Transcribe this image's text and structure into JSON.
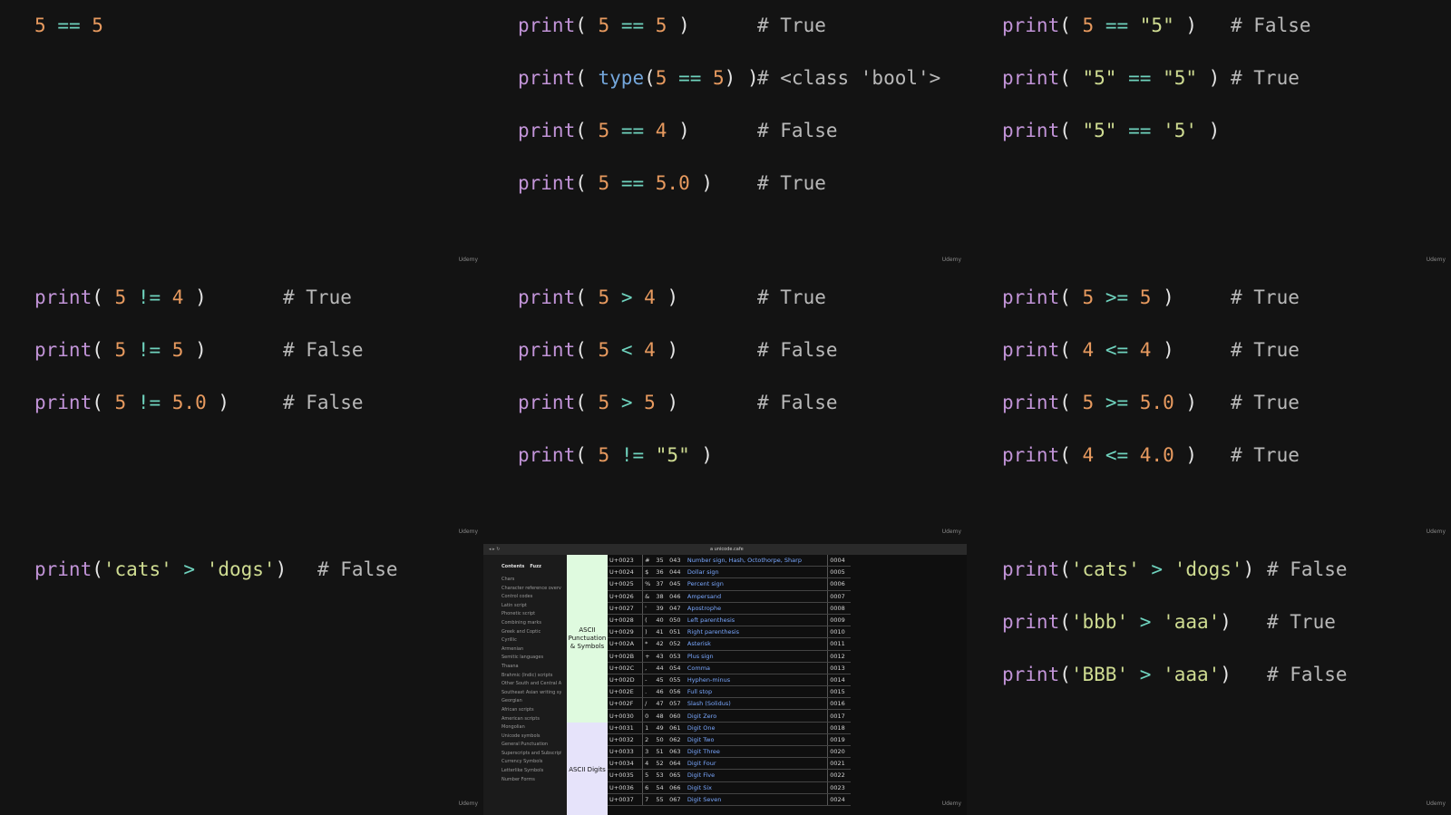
{
  "watermark": "Udemy",
  "panels": [
    {
      "lines": [
        {
          "code": [
            [
              "n",
              "5"
            ],
            [
              "p",
              " "
            ],
            [
              "o",
              "=="
            ],
            [
              "p",
              " "
            ],
            [
              "n",
              "5"
            ]
          ],
          "comment": ""
        }
      ]
    },
    {
      "lines": [
        {
          "code": [
            [
              "fn",
              "print"
            ],
            [
              "p",
              "( "
            ],
            [
              "n",
              "5"
            ],
            [
              "p",
              " "
            ],
            [
              "o",
              "=="
            ],
            [
              "p",
              " "
            ],
            [
              "n",
              "5"
            ],
            [
              "p",
              " )"
            ]
          ],
          "comment": "# True"
        },
        {
          "code": [
            [
              "fn",
              "print"
            ],
            [
              "p",
              "( "
            ],
            [
              "t",
              "type"
            ],
            [
              "p",
              "("
            ],
            [
              "n",
              "5"
            ],
            [
              "p",
              " "
            ],
            [
              "o",
              "=="
            ],
            [
              "p",
              " "
            ],
            [
              "n",
              "5"
            ],
            [
              "p",
              ") )"
            ]
          ],
          "comment": "# <class 'bool'>"
        },
        {
          "code": [
            [
              "fn",
              "print"
            ],
            [
              "p",
              "( "
            ],
            [
              "n",
              "5"
            ],
            [
              "p",
              " "
            ],
            [
              "o",
              "=="
            ],
            [
              "p",
              " "
            ],
            [
              "n",
              "4"
            ],
            [
              "p",
              " )"
            ]
          ],
          "comment": "# False"
        },
        {
          "code": [
            [
              "fn",
              "print"
            ],
            [
              "p",
              "( "
            ],
            [
              "n",
              "5"
            ],
            [
              "p",
              " "
            ],
            [
              "o",
              "=="
            ],
            [
              "p",
              " "
            ],
            [
              "n",
              "5.0"
            ],
            [
              "p",
              " )"
            ]
          ],
          "comment": "# True"
        }
      ]
    },
    {
      "lines": [
        {
          "code": [
            [
              "fn",
              "print"
            ],
            [
              "p",
              "( "
            ],
            [
              "n",
              "5"
            ],
            [
              "p",
              " "
            ],
            [
              "o",
              "=="
            ],
            [
              "p",
              " "
            ],
            [
              "s",
              "\"5\""
            ],
            [
              "p",
              " )"
            ]
          ],
          "comment": "# False"
        },
        {
          "code": [
            [
              "fn",
              "print"
            ],
            [
              "p",
              "( "
            ],
            [
              "s",
              "\"5\""
            ],
            [
              "p",
              " "
            ],
            [
              "o",
              "=="
            ],
            [
              "p",
              " "
            ],
            [
              "s",
              "\"5\""
            ],
            [
              "p",
              " )"
            ]
          ],
          "comment": "# True"
        },
        {
          "code": [
            [
              "fn",
              "print"
            ],
            [
              "p",
              "( "
            ],
            [
              "s",
              "\"5\""
            ],
            [
              "p",
              " "
            ],
            [
              "o",
              "=="
            ],
            [
              "p",
              " "
            ],
            [
              "s",
              "'5'"
            ],
            [
              "p",
              " )"
            ]
          ],
          "comment": ""
        }
      ]
    },
    {
      "lines": [
        {
          "code": [
            [
              "fn",
              "print"
            ],
            [
              "p",
              "( "
            ],
            [
              "n",
              "5"
            ],
            [
              "p",
              " "
            ],
            [
              "o",
              "!="
            ],
            [
              "p",
              " "
            ],
            [
              "n",
              "4"
            ],
            [
              "p",
              " )"
            ]
          ],
          "comment": "# True"
        },
        {
          "code": [
            [
              "fn",
              "print"
            ],
            [
              "p",
              "( "
            ],
            [
              "n",
              "5"
            ],
            [
              "p",
              " "
            ],
            [
              "o",
              "!="
            ],
            [
              "p",
              " "
            ],
            [
              "n",
              "5"
            ],
            [
              "p",
              " )"
            ]
          ],
          "comment": "# False"
        },
        {
          "code": [
            [
              "fn",
              "print"
            ],
            [
              "p",
              "( "
            ],
            [
              "n",
              "5"
            ],
            [
              "p",
              " "
            ],
            [
              "o",
              "!="
            ],
            [
              "p",
              " "
            ],
            [
              "n",
              "5.0"
            ],
            [
              "p",
              " )"
            ]
          ],
          "comment": "# False"
        }
      ]
    },
    {
      "lines": [
        {
          "code": [
            [
              "fn",
              "print"
            ],
            [
              "p",
              "( "
            ],
            [
              "n",
              "5"
            ],
            [
              "p",
              " "
            ],
            [
              "o",
              ">"
            ],
            [
              "p",
              " "
            ],
            [
              "n",
              "4"
            ],
            [
              "p",
              " )"
            ]
          ],
          "comment": "# True"
        },
        {
          "code": [
            [
              "fn",
              "print"
            ],
            [
              "p",
              "( "
            ],
            [
              "n",
              "5"
            ],
            [
              "p",
              " "
            ],
            [
              "o",
              "<"
            ],
            [
              "p",
              " "
            ],
            [
              "n",
              "4"
            ],
            [
              "p",
              " )"
            ]
          ],
          "comment": "# False"
        },
        {
          "code": [
            [
              "fn",
              "print"
            ],
            [
              "p",
              "( "
            ],
            [
              "n",
              "5"
            ],
            [
              "p",
              " "
            ],
            [
              "o",
              ">"
            ],
            [
              "p",
              " "
            ],
            [
              "n",
              "5"
            ],
            [
              "p",
              " )"
            ]
          ],
          "comment": "# False"
        },
        {
          "code": [
            [
              "fn",
              "print"
            ],
            [
              "p",
              "( "
            ],
            [
              "n",
              "5"
            ],
            [
              "p",
              " "
            ],
            [
              "o",
              "!="
            ],
            [
              "p",
              " "
            ],
            [
              "s",
              "\"5\""
            ],
            [
              "p",
              " )"
            ]
          ],
          "comment": ""
        }
      ]
    },
    {
      "lines": [
        {
          "code": [
            [
              "fn",
              "print"
            ],
            [
              "p",
              "( "
            ],
            [
              "n",
              "5"
            ],
            [
              "p",
              " "
            ],
            [
              "o",
              ">="
            ],
            [
              "p",
              " "
            ],
            [
              "n",
              "5"
            ],
            [
              "p",
              " )"
            ]
          ],
          "comment": "# True"
        },
        {
          "code": [
            [
              "fn",
              "print"
            ],
            [
              "p",
              "( "
            ],
            [
              "n",
              "4"
            ],
            [
              "p",
              " "
            ],
            [
              "o",
              "<="
            ],
            [
              "p",
              " "
            ],
            [
              "n",
              "4"
            ],
            [
              "p",
              " )"
            ]
          ],
          "comment": "# True"
        },
        {
          "code": [
            [
              "fn",
              "print"
            ],
            [
              "p",
              "( "
            ],
            [
              "n",
              "5"
            ],
            [
              "p",
              " "
            ],
            [
              "o",
              ">="
            ],
            [
              "p",
              " "
            ],
            [
              "n",
              "5.0"
            ],
            [
              "p",
              " )"
            ]
          ],
          "comment": "# True"
        },
        {
          "code": [
            [
              "fn",
              "print"
            ],
            [
              "p",
              "( "
            ],
            [
              "n",
              "4"
            ],
            [
              "p",
              " "
            ],
            [
              "o",
              "<="
            ],
            [
              "p",
              " "
            ],
            [
              "n",
              "4.0"
            ],
            [
              "p",
              " )"
            ]
          ],
          "comment": "# True"
        }
      ]
    },
    {
      "lines": [
        {
          "code": [
            [
              "fn",
              "print"
            ],
            [
              "p",
              "("
            ],
            [
              "s",
              "'cats'"
            ],
            [
              "p",
              " "
            ],
            [
              "o",
              ">"
            ],
            [
              "p",
              " "
            ],
            [
              "s",
              "'dogs'"
            ],
            [
              "p",
              ")"
            ]
          ],
          "comment": "# False"
        }
      ]
    },
    {
      "browser": true
    },
    {
      "lines": [
        {
          "code": [
            [
              "fn",
              "print"
            ],
            [
              "p",
              "("
            ],
            [
              "s",
              "'cats'"
            ],
            [
              "p",
              " "
            ],
            [
              "o",
              ">"
            ],
            [
              "p",
              " "
            ],
            [
              "s",
              "'dogs'"
            ],
            [
              "p",
              ")"
            ]
          ],
          "comment": "# False"
        },
        {
          "code": [
            [
              "fn",
              "print"
            ],
            [
              "p",
              "("
            ],
            [
              "s",
              "'bbb'"
            ],
            [
              "p",
              " "
            ],
            [
              "o",
              ">"
            ],
            [
              "p",
              " "
            ],
            [
              "s",
              "'aaa'"
            ],
            [
              "p",
              ")"
            ]
          ],
          "comment": "# True"
        },
        {
          "code": [
            [
              "fn",
              "print"
            ],
            [
              "p",
              "("
            ],
            [
              "s",
              "'BBB'"
            ],
            [
              "p",
              " "
            ],
            [
              "o",
              ">"
            ],
            [
              "p",
              " "
            ],
            [
              "s",
              "'aaa'"
            ],
            [
              "p",
              ")"
            ]
          ],
          "comment": "# False"
        }
      ]
    }
  ],
  "browser": {
    "url": "a unicode.cafe",
    "controls": "◂ ▸  ↻",
    "sidebar_tabs": [
      "Contents",
      "Fuzz"
    ],
    "sidebar_items": [
      "Chars",
      "Character reference overview",
      "Control codes",
      "Latin script",
      "Phonetic script",
      "Combining marks",
      "Greek and Coptic",
      "Cyrillic",
      "Armenian",
      "Semitic languages",
      "Thaana",
      "Brahmic (Indic) scripts",
      "Other South and Central Asian writing systems",
      "Southeast Asian writing systems",
      "Georgian",
      "African scripts",
      "American scripts",
      "Mongolian",
      "Unicode symbols",
      "General Punctuation",
      "Superscripts and Subscripts",
      "Currency Symbols",
      "Letterlike Symbols",
      "Number Forms"
    ],
    "groups": [
      {
        "label": "ASCII Punctuation & Symbols",
        "color": "#dffadf",
        "rows": 14
      },
      {
        "label": "ASCII Digits",
        "color": "#e6e3fa",
        "rows": 8
      }
    ],
    "rows": [
      [
        "U+0023",
        "#",
        "35",
        "043",
        "Number sign, Hash, Octothorpe, Sharp",
        "0004"
      ],
      [
        "U+0024",
        "$",
        "36",
        "044",
        "Dollar sign",
        "0005"
      ],
      [
        "U+0025",
        "%",
        "37",
        "045",
        "Percent sign",
        "0006"
      ],
      [
        "U+0026",
        "&",
        "38",
        "046",
        "Ampersand",
        "0007"
      ],
      [
        "U+0027",
        "'",
        "39",
        "047",
        "Apostrophe",
        "0008"
      ],
      [
        "U+0028",
        "(",
        "40",
        "050",
        "Left parenthesis",
        "0009"
      ],
      [
        "U+0029",
        ")",
        "41",
        "051",
        "Right parenthesis",
        "0010"
      ],
      [
        "U+002A",
        "*",
        "42",
        "052",
        "Asterisk",
        "0011"
      ],
      [
        "U+002B",
        "+",
        "43",
        "053",
        "Plus sign",
        "0012"
      ],
      [
        "U+002C",
        ",",
        "44",
        "054",
        "Comma",
        "0013"
      ],
      [
        "U+002D",
        "-",
        "45",
        "055",
        "Hyphen-minus",
        "0014"
      ],
      [
        "U+002E",
        ".",
        "46",
        "056",
        "Full stop",
        "0015"
      ],
      [
        "U+002F",
        "/",
        "47",
        "057",
        "Slash (Solidus)",
        "0016"
      ],
      [
        "U+0030",
        "0",
        "48",
        "060",
        "Digit Zero",
        "0017"
      ],
      [
        "U+0031",
        "1",
        "49",
        "061",
        "Digit One",
        "0018"
      ],
      [
        "U+0032",
        "2",
        "50",
        "062",
        "Digit Two",
        "0019"
      ],
      [
        "U+0033",
        "3",
        "51",
        "063",
        "Digit Three",
        "0020"
      ],
      [
        "U+0034",
        "4",
        "52",
        "064",
        "Digit Four",
        "0021"
      ],
      [
        "U+0035",
        "5",
        "53",
        "065",
        "Digit Five",
        "0022"
      ],
      [
        "U+0036",
        "6",
        "54",
        "066",
        "Digit Six",
        "0023"
      ],
      [
        "U+0037",
        "7",
        "55",
        "067",
        "Digit Seven",
        "0024"
      ]
    ]
  }
}
